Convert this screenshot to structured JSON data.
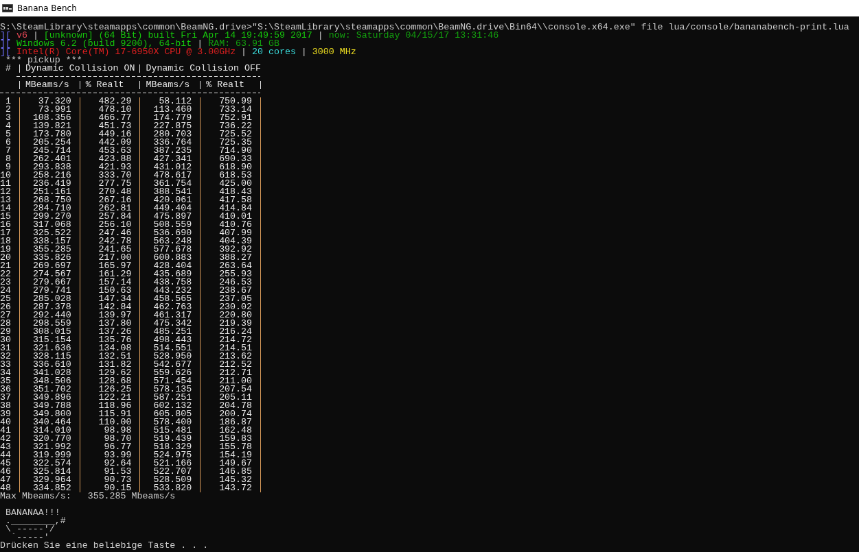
{
  "window": {
    "title": "Banana Bench"
  },
  "command_line": "S:\\SteamLibrary\\steamapps\\common\\BeamNG.drive>\"S:\\SteamLibrary\\steamapps\\common\\BeamNG.drive\\Bin64\\\\console.x64.exe\" file lua/console/bananabench-print.lua",
  "info_lines": [
    {
      "segments": [
        {
          "text": "][",
          "color": "#7070ff"
        },
        {
          "text": "v6",
          "color": "#e74856"
        },
        {
          "text": "|"
        },
        {
          "text": "[unknown] (64 Bit) built Fri Apr 14 19:49:59 2017",
          "color": "#16c60c"
        },
        {
          "text": "|"
        },
        {
          "text": "now: Saturday 04/15/17 13:31:46",
          "color": "#13a10e"
        }
      ]
    },
    {
      "segments": [
        {
          "text": "][",
          "color": "#7070ff"
        },
        {
          "text": "Windows 6.2 (build 9200), 64-bit",
          "color": "#16c60c"
        },
        {
          "text": "|"
        },
        {
          "text": "RAM: 63.91 GB",
          "color": "#13a10e"
        }
      ]
    },
    {
      "segments": [
        {
          "text": "][",
          "color": "#7070ff"
        },
        {
          "text": "Intel(R) Core(TM) i7-6950X CPU @ 3.00GHz",
          "color": "#e02020"
        },
        {
          "text": "|"
        },
        {
          "text": "20 cores",
          "color": "#3adada"
        },
        {
          "text": "|"
        },
        {
          "text": "3000 MHz",
          "color": "#f0e020"
        }
      ]
    }
  ],
  "benchmark_title": "*** pickup ***",
  "table": {
    "index_heading": "#",
    "groups": [
      "Dynamic Collision ON",
      "Dynamic Collision OFF"
    ],
    "columns": [
      "",
      "MBeams/s",
      "% Realt",
      "MBeams/s",
      "% Realt"
    ],
    "rows": [
      [
        "1",
        "37.320",
        "482.29",
        "58.112",
        "750.99"
      ],
      [
        "2",
        "73.991",
        "478.10",
        "113.460",
        "733.14"
      ],
      [
        "3",
        "108.356",
        "466.77",
        "174.779",
        "752.91"
      ],
      [
        "4",
        "139.821",
        "451.73",
        "227.875",
        "736.22"
      ],
      [
        "5",
        "173.780",
        "449.16",
        "280.703",
        "725.52"
      ],
      [
        "6",
        "205.254",
        "442.09",
        "336.764",
        "725.35"
      ],
      [
        "7",
        "245.714",
        "453.63",
        "387.235",
        "714.90"
      ],
      [
        "8",
        "262.401",
        "423.88",
        "427.341",
        "690.33"
      ],
      [
        "9",
        "293.838",
        "421.93",
        "431.012",
        "618.90"
      ],
      [
        "10",
        "258.216",
        "333.70",
        "478.617",
        "618.53"
      ],
      [
        "11",
        "236.419",
        "277.75",
        "361.754",
        "425.00"
      ],
      [
        "12",
        "251.161",
        "270.48",
        "388.541",
        "418.43"
      ],
      [
        "13",
        "268.750",
        "267.16",
        "420.061",
        "417.58"
      ],
      [
        "14",
        "284.710",
        "262.81",
        "449.404",
        "414.84"
      ],
      [
        "15",
        "299.270",
        "257.84",
        "475.897",
        "410.01"
      ],
      [
        "16",
        "317.068",
        "256.10",
        "508.559",
        "410.76"
      ],
      [
        "17",
        "325.522",
        "247.46",
        "536.690",
        "407.99"
      ],
      [
        "18",
        "338.157",
        "242.78",
        "563.248",
        "404.39"
      ],
      [
        "19",
        "355.285",
        "241.65",
        "577.678",
        "392.92"
      ],
      [
        "20",
        "335.826",
        "217.00",
        "600.883",
        "388.27"
      ],
      [
        "21",
        "269.697",
        "165.97",
        "428.404",
        "263.64"
      ],
      [
        "22",
        "274.567",
        "161.29",
        "435.689",
        "255.93"
      ],
      [
        "23",
        "279.667",
        "157.14",
        "438.758",
        "246.53"
      ],
      [
        "24",
        "279.741",
        "150.63",
        "443.232",
        "238.67"
      ],
      [
        "25",
        "285.028",
        "147.34",
        "458.565",
        "237.05"
      ],
      [
        "26",
        "287.378",
        "142.84",
        "462.763",
        "230.02"
      ],
      [
        "27",
        "292.440",
        "139.97",
        "461.317",
        "220.80"
      ],
      [
        "28",
        "298.559",
        "137.80",
        "475.342",
        "219.39"
      ],
      [
        "29",
        "308.015",
        "137.26",
        "485.251",
        "216.24"
      ],
      [
        "30",
        "315.154",
        "135.76",
        "498.443",
        "214.72"
      ],
      [
        "31",
        "321.636",
        "134.08",
        "514.551",
        "214.51"
      ],
      [
        "32",
        "328.115",
        "132.51",
        "528.950",
        "213.62"
      ],
      [
        "33",
        "336.610",
        "131.82",
        "542.677",
        "212.52"
      ],
      [
        "34",
        "341.028",
        "129.62",
        "559.626",
        "212.71"
      ],
      [
        "35",
        "348.506",
        "128.68",
        "571.454",
        "211.00"
      ],
      [
        "36",
        "351.702",
        "126.25",
        "578.135",
        "207.54"
      ],
      [
        "37",
        "349.896",
        "122.21",
        "587.251",
        "205.11"
      ],
      [
        "38",
        "349.788",
        "118.96",
        "602.132",
        "204.78"
      ],
      [
        "39",
        "349.800",
        "115.91",
        "605.805",
        "200.74"
      ],
      [
        "40",
        "340.464",
        "110.00",
        "578.400",
        "186.87"
      ],
      [
        "41",
        "314.010",
        "98.98",
        "515.481",
        "162.48"
      ],
      [
        "42",
        "320.770",
        "98.70",
        "519.439",
        "159.83"
      ],
      [
        "43",
        "321.992",
        "96.77",
        "518.329",
        "155.78"
      ],
      [
        "44",
        "319.999",
        "93.99",
        "524.975",
        "154.19"
      ],
      [
        "45",
        "322.574",
        "92.64",
        "521.166",
        "149.67"
      ],
      [
        "46",
        "325.814",
        "91.53",
        "522.707",
        "146.85"
      ],
      [
        "47",
        "329.964",
        "90.73",
        "528.509",
        "145.32"
      ],
      [
        "48",
        "334.852",
        "90.15",
        "533.820",
        "143.72"
      ]
    ]
  },
  "summary": "Max Mbeams/s:   355.285 Mbeams/s",
  "banana_art": [
    "BANANAA!!!",
    ".________,#",
    "\\ -----'/",
    " `-----'"
  ],
  "prompt": "Drücken Sie eine beliebige Taste . . ."
}
